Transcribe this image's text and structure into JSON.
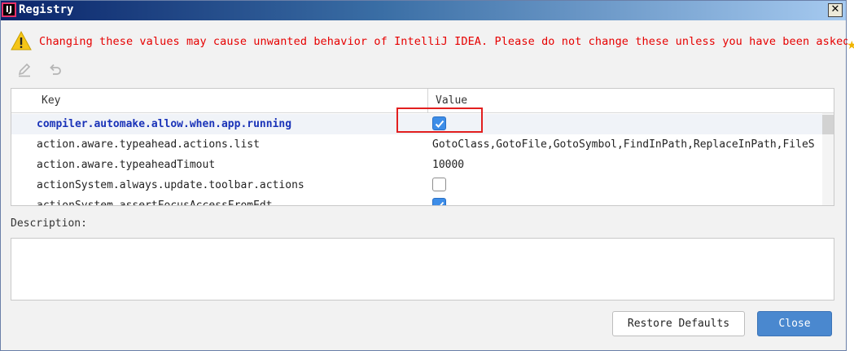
{
  "window": {
    "title": "Registry",
    "app_icon_label": "IJ",
    "close_glyph": "✕"
  },
  "warning": {
    "text": "Changing these values may cause unwanted behavior of IntelliJ IDEA. Please do not change these unless you have been asked.",
    "color": "#e60000"
  },
  "toolbar": {
    "edit_icon": "pencil-icon",
    "revert_icon": "undo-icon"
  },
  "table": {
    "columns": [
      "Key",
      "Value"
    ],
    "rows": [
      {
        "key": "compiler.automake.allow.when.app.running",
        "type": "checkbox",
        "checked": true,
        "changed": true
      },
      {
        "key": "action.aware.typeahead.actions.list",
        "type": "text",
        "value": "GotoClass,GotoFile,GotoSymbol,FindInPath,ReplaceInPath,FileS"
      },
      {
        "key": "action.aware.typeaheadTimout",
        "type": "text",
        "value": "10000"
      },
      {
        "key": "actionSystem.always.update.toolbar.actions",
        "type": "checkbox",
        "checked": false
      },
      {
        "key": "actionSystem.assertFocusAccessFromEdt",
        "type": "checkbox",
        "checked": true
      }
    ]
  },
  "description": {
    "label": "Description:",
    "value": ""
  },
  "buttons": {
    "restore": "Restore Defaults",
    "close": "Close"
  },
  "colors": {
    "accent": "#4a88cf",
    "changed_key": "#1a33b8",
    "highlight": "#e21f1f"
  }
}
